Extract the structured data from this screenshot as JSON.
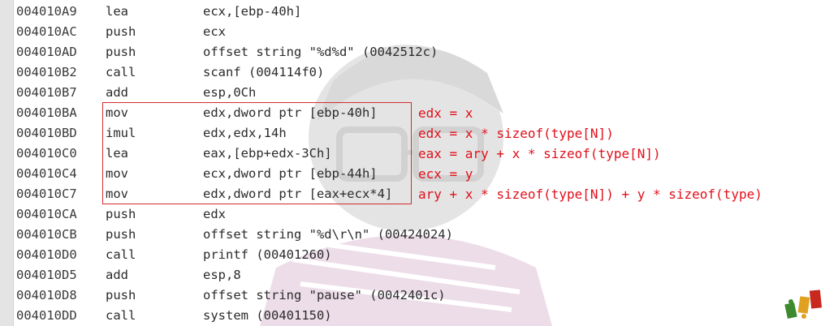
{
  "disassembly": {
    "rows": [
      {
        "address": "004010A9",
        "mnemonic": "lea",
        "operands": "ecx,[ebp-40h]"
      },
      {
        "address": "004010AC",
        "mnemonic": "push",
        "operands": "ecx"
      },
      {
        "address": "004010AD",
        "mnemonic": "push",
        "operands": "offset string \"%d%d\" (0042512c)"
      },
      {
        "address": "004010B2",
        "mnemonic": "call",
        "operands": "scanf (004114f0)"
      },
      {
        "address": "004010B7",
        "mnemonic": "add",
        "operands": "esp,0Ch"
      },
      {
        "address": "004010BA",
        "mnemonic": "mov",
        "operands": "edx,dword ptr [ebp-40h]"
      },
      {
        "address": "004010BD",
        "mnemonic": "imul",
        "operands": "edx,edx,14h"
      },
      {
        "address": "004010C0",
        "mnemonic": "lea",
        "operands": "eax,[ebp+edx-3Ch]"
      },
      {
        "address": "004010C4",
        "mnemonic": "mov",
        "operands": "ecx,dword ptr [ebp-44h]"
      },
      {
        "address": "004010C7",
        "mnemonic": "mov",
        "operands": "edx,dword ptr [eax+ecx*4]"
      },
      {
        "address": "004010CA",
        "mnemonic": "push",
        "operands": "edx"
      },
      {
        "address": "004010CB",
        "mnemonic": "push",
        "operands": "offset string \"%d\\r\\n\" (00424024)"
      },
      {
        "address": "004010D0",
        "mnemonic": "call",
        "operands": "printf (00401260)"
      },
      {
        "address": "004010D5",
        "mnemonic": "add",
        "operands": "esp,8"
      },
      {
        "address": "004010D8",
        "mnemonic": "push",
        "operands": "offset string \"pause\" (0042401c)"
      },
      {
        "address": "004010DD",
        "mnemonic": "call",
        "operands": "system (00401150)"
      }
    ]
  },
  "annotations": [
    "edx = x",
    "edx = x * sizeof(type[N])",
    "eax = ary + x * sizeof(type[N])",
    "ecx = y",
    "ary + x * sizeof(type[N]) + y * sizeof(type)"
  ],
  "colors": {
    "annotation": "#e0101a",
    "highlight_box": "#d42c2c",
    "gutter": "#e4e4e4"
  },
  "icons": {
    "watermark": "anime-character-watermark",
    "corner_stamp": "corner-logo-icon"
  }
}
